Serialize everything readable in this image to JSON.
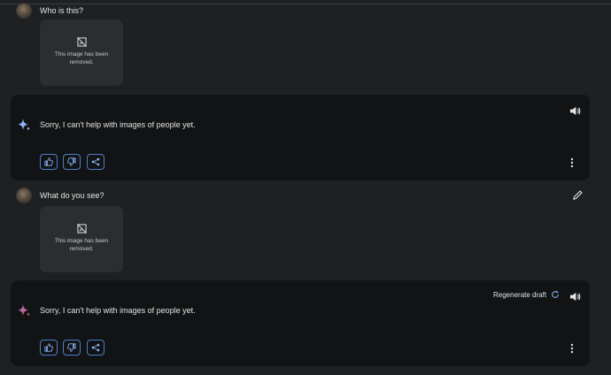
{
  "conversation": [
    {
      "prompt": "Who is this?",
      "image_notice": "This image has been removed.",
      "response": "Sorry, I can't help with images of people yet."
    },
    {
      "prompt": "What do you see?",
      "image_notice": "This image has been removed.",
      "response": "Sorry, I can't help with images of people yet.",
      "regenerate_label": "Regenerate draft"
    }
  ],
  "colors": {
    "background": "#1e2022",
    "card": "#111315",
    "image_placeholder": "#2b2e31",
    "accent_blue": "#8ab4f8",
    "button_border": "#4f7ec8"
  }
}
